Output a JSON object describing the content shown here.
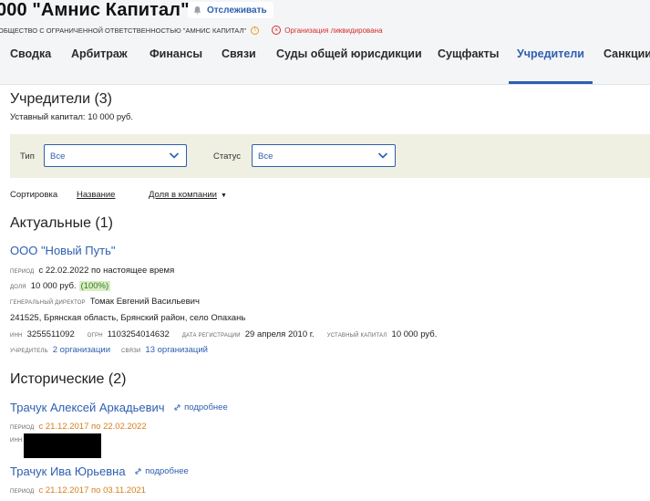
{
  "header": {
    "title": "000 \"Амнис Капитал\"",
    "track_label": "Отслеживать",
    "org_form": "ОБЩЕСТВО С ОГРАНИЧЕННОЙ ОТВЕТСТВЕННОСТЬЮ \"АМНИС КАПИТАЛ\"",
    "status": "Организация ликвидирована"
  },
  "tabs": [
    {
      "label": "Сводка"
    },
    {
      "label": "Арбитраж"
    },
    {
      "label": "Финансы"
    },
    {
      "label": "Связи"
    },
    {
      "label": "Суды общей юрисдикции"
    },
    {
      "label": "Сущфакты"
    },
    {
      "label": "Учредители",
      "active": true
    },
    {
      "label": "Санкции"
    }
  ],
  "page": {
    "heading": "Учредители (3)",
    "capital": "Уставный капитал: 10 000 руб."
  },
  "filters": {
    "type_label": "Тип",
    "type_value": "Все",
    "status_label": "Статус",
    "status_value": "Все"
  },
  "sort": {
    "label": "Сортировка",
    "by_name": "Название",
    "by_share": "Доля в компании"
  },
  "actual": {
    "heading": "Актуальные (1)",
    "name": "ООО \"Новый Путь\"",
    "period_cap": "период",
    "period": "с 22.02.2022 по настоящее время",
    "share_cap": "доля",
    "share": "10 000 руб.",
    "share_pct": "(100%)",
    "director_cap": "генеральный директор",
    "director": "Томак Евгений Васильевич",
    "address": "241525, Брянская область, Брянский район, село Опахань",
    "inn_cap": "инн",
    "inn": "3255511092",
    "ogrn_cap": "огрн",
    "ogrn": "1103254014632",
    "reg_cap": "дата регистрации",
    "reg": "29 апреля 2010 г.",
    "capital_cap": "уставный капитал",
    "capital": "10 000 руб.",
    "founder_cap": "учредитель",
    "founder_link": "2 организации",
    "links_cap": "связи",
    "links_link": "13 организаций"
  },
  "historical": {
    "heading": "Исторические (2)",
    "more_label": "подробнее",
    "items": [
      {
        "name": "Трачук Алексей Аркадьевич",
        "period_cap": "период",
        "period": "с 21.12.2017 по 22.02.2022",
        "inn_cap": "инн"
      },
      {
        "name": "Трачук Ива Юрьевна",
        "period_cap": "период",
        "period": "с 21.12.2017 по 03.11.2021"
      }
    ]
  },
  "colors": {
    "accent": "#2d5fb0",
    "liquidated": "#d62d2d",
    "period_hist": "#d67e1a",
    "filter_bg": "#efefe2"
  }
}
